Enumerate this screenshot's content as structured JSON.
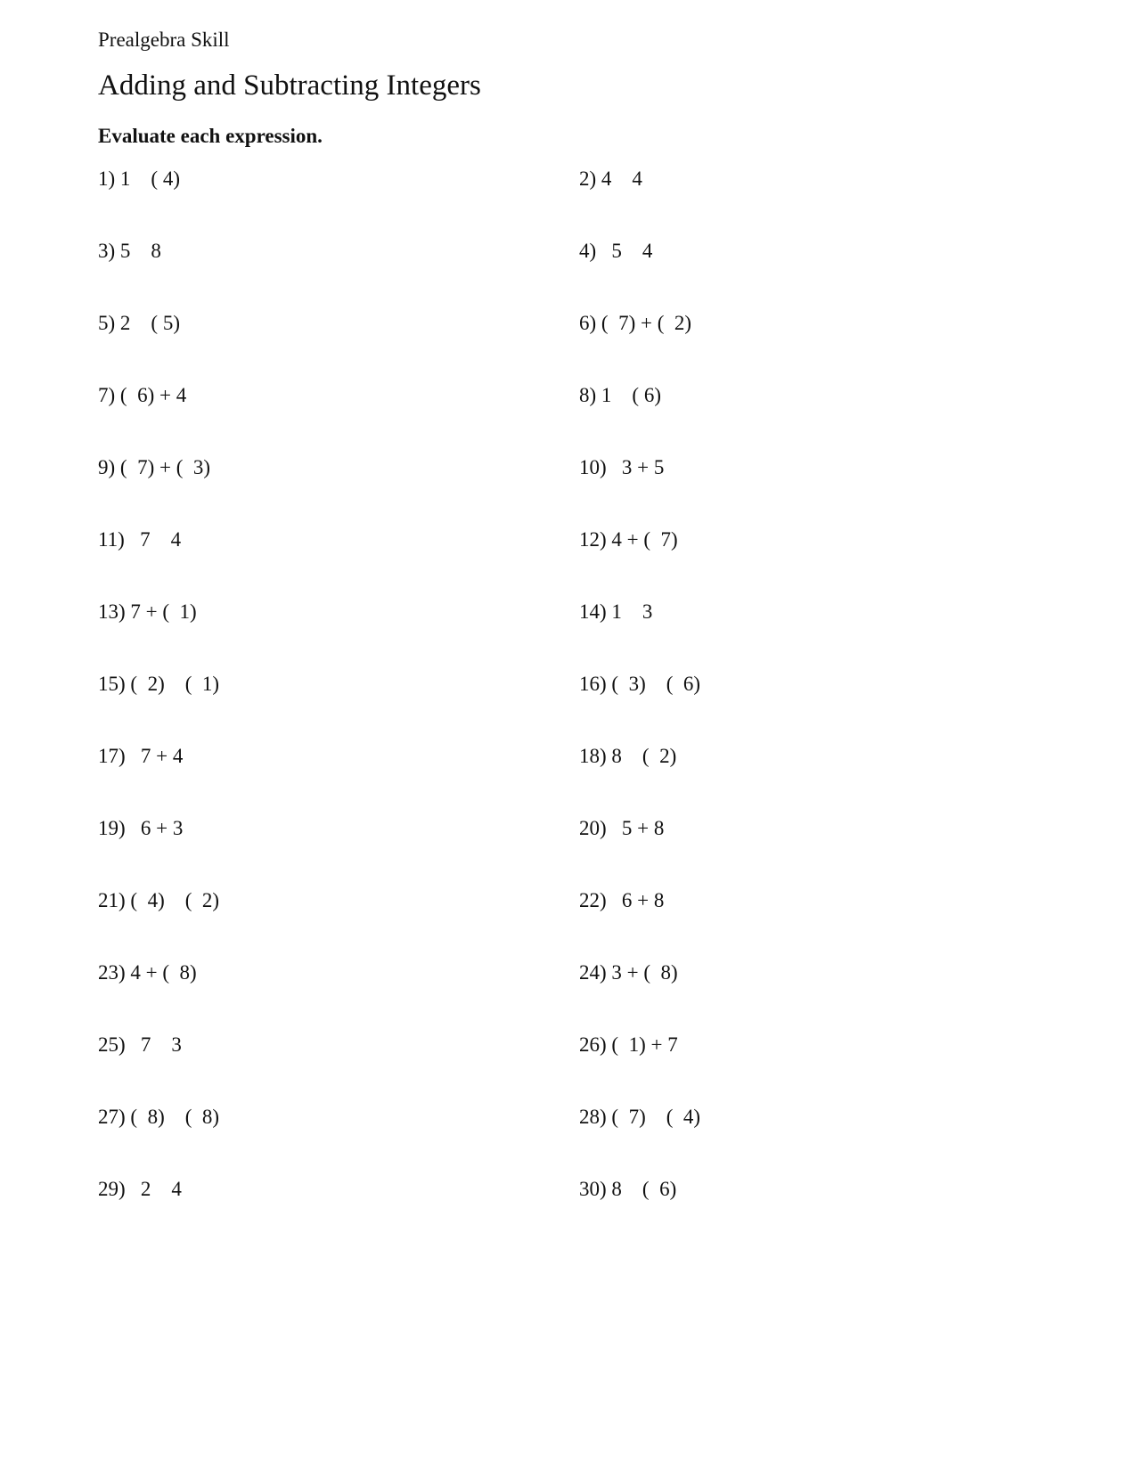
{
  "header": {
    "subject": "Prealgebra Skill",
    "title": "Adding and Subtracting Integers",
    "instructions": "Evaluate each expression."
  },
  "problems": [
    {
      "number": "1)",
      "expression": "1    ( 4)"
    },
    {
      "number": "2)",
      "expression": "4    4"
    },
    {
      "number": "3)",
      "expression": "5    8"
    },
    {
      "number": "4)",
      "expression": "  5    4"
    },
    {
      "number": "5)",
      "expression": "2    ( 5)"
    },
    {
      "number": "6)",
      "expression": "(  7) + (  2)"
    },
    {
      "number": "7)",
      "expression": "(  6) + 4"
    },
    {
      "number": "8)",
      "expression": "1    ( 6)"
    },
    {
      "number": "9)",
      "expression": "(  7) + (  3)"
    },
    {
      "number": "10)",
      "expression": "  3 + 5"
    },
    {
      "number": "11)",
      "expression": "  7    4"
    },
    {
      "number": "12)",
      "expression": "4 + (  7)"
    },
    {
      "number": "13)",
      "expression": "7 + (  1)"
    },
    {
      "number": "14)",
      "expression": "1    3"
    },
    {
      "number": "15)",
      "expression": "(  2)    (  1)"
    },
    {
      "number": "16)",
      "expression": "(  3)    (  6)"
    },
    {
      "number": "17)",
      "expression": "  7 + 4"
    },
    {
      "number": "18)",
      "expression": "8    (  2)"
    },
    {
      "number": "19)",
      "expression": "  6 + 3"
    },
    {
      "number": "20)",
      "expression": "  5 + 8"
    },
    {
      "number": "21)",
      "expression": "(  4)    (  2)"
    },
    {
      "number": "22)",
      "expression": "  6 + 8"
    },
    {
      "number": "23)",
      "expression": "4 + (  8)"
    },
    {
      "number": "24)",
      "expression": "3 + (  8)"
    },
    {
      "number": "25)",
      "expression": "  7    3"
    },
    {
      "number": "26)",
      "expression": "(  1) + 7"
    },
    {
      "number": "27)",
      "expression": "(  8)    (  8)"
    },
    {
      "number": "28)",
      "expression": "(  7)    (  4)"
    },
    {
      "number": "29)",
      "expression": "  2    4"
    },
    {
      "number": "30)",
      "expression": "8    (  6)"
    }
  ]
}
